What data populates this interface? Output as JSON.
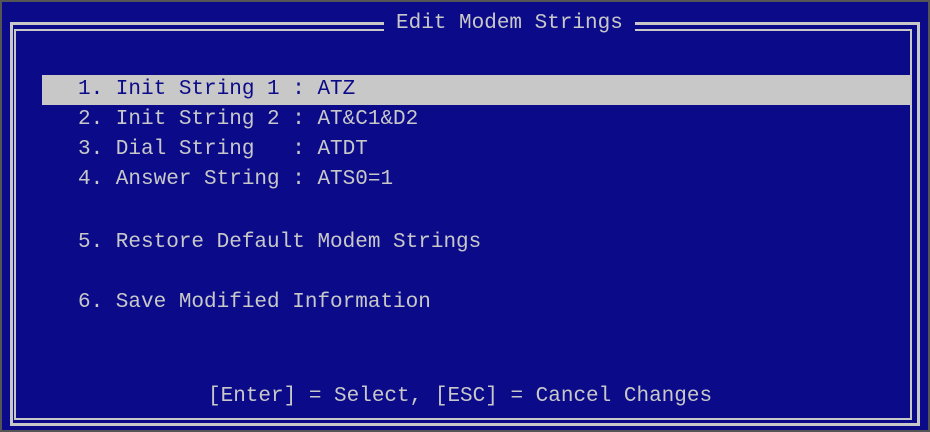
{
  "window": {
    "title": "Edit Modem Strings"
  },
  "menu": {
    "items": [
      {
        "label": "1. Init String 1 : ATZ",
        "selected": true
      },
      {
        "label": "2. Init String 2 : AT&C1&D2",
        "selected": false
      },
      {
        "label": "3. Dial String   : ATDT",
        "selected": false
      },
      {
        "label": "4. Answer String : ATS0=1",
        "selected": false
      },
      {
        "label": "5. Restore Default Modem Strings",
        "selected": false
      },
      {
        "label": "6. Save Modified Information",
        "selected": false
      }
    ]
  },
  "footer": {
    "hint": "[Enter] = Select, [ESC] = Cancel Changes"
  },
  "colors": {
    "background": "#0b0b8a",
    "foreground": "#c8c8c8",
    "highlight": "#c8c8c8"
  }
}
